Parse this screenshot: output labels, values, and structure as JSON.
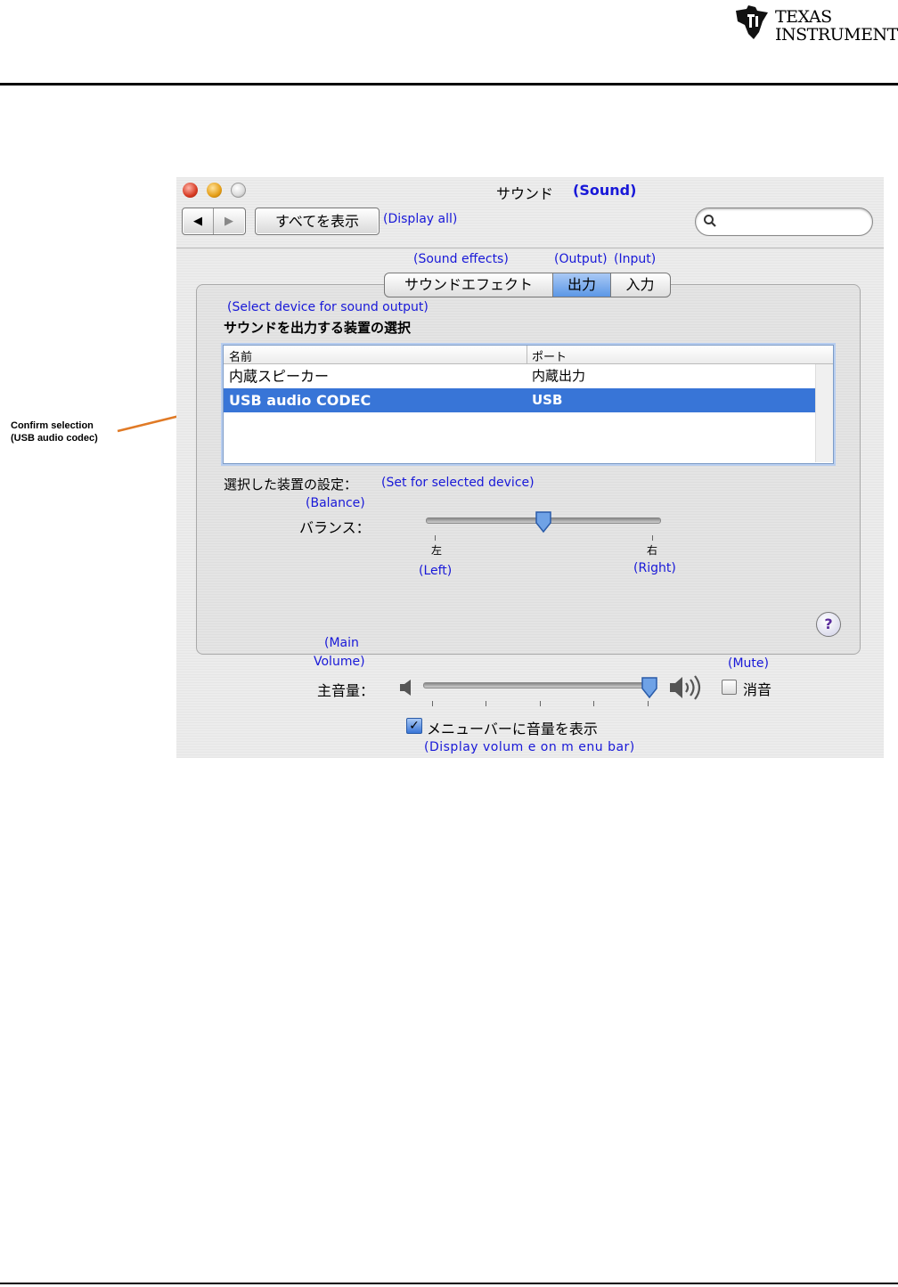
{
  "header": {
    "logo_line1": "Texas",
    "logo_line2": "Instruments"
  },
  "window": {
    "title_ja": "サウンド",
    "title_en": "(Sound)",
    "toolbar": {
      "back_icon": "◀",
      "forward_icon": "▶",
      "show_all_label": "すべてを表示",
      "show_all_en": "(Display all)",
      "search_placeholder": ""
    },
    "tabs": {
      "sound_effects_en": "(Sound effects)",
      "output_en": "(Output)",
      "input_en": "(Input)",
      "sound_effects": "サウンドエフェクト",
      "output": "出力",
      "input": "入力",
      "selected": "出力"
    },
    "device_section": {
      "heading_en": "(Select device for sound output)",
      "heading_ja": "サウンドを出力する装置の選択",
      "columns": [
        "名前",
        "ポート"
      ],
      "rows": [
        {
          "name": "内蔵スピーカー",
          "port": "内蔵出力"
        },
        {
          "name": "USB audio CODEC",
          "port": "USB",
          "selected": true
        }
      ]
    },
    "settings": {
      "label_ja": "選択した装置の設定：",
      "label_en": "(Set for selected device)",
      "balance_en": "(Balance)",
      "balance_ja": "バランス：",
      "balance_value": 0.5,
      "left_ja": "左",
      "right_ja": "右",
      "left_en": "(Left)",
      "right_en": "(Right)",
      "help_label": "?"
    },
    "volume": {
      "main_en_line1": "(Main",
      "main_en_line2": "Volume)",
      "main_ja": "主音量：",
      "level": 0.98,
      "mute_en": "(Mute)",
      "mute_ja": "消音",
      "mute_checked": false,
      "menubar_ja": "メニューバーに音量を表示",
      "menubar_en": "(Display volum e on m enu bar)",
      "menubar_checked": true
    }
  },
  "annotation": {
    "line1": "Confirm selection",
    "line2": "(USB audio codec)",
    "arrow_color": "#e07a26"
  },
  "colors": {
    "selection": "#3875d7",
    "english_labels": "#1818d8"
  }
}
